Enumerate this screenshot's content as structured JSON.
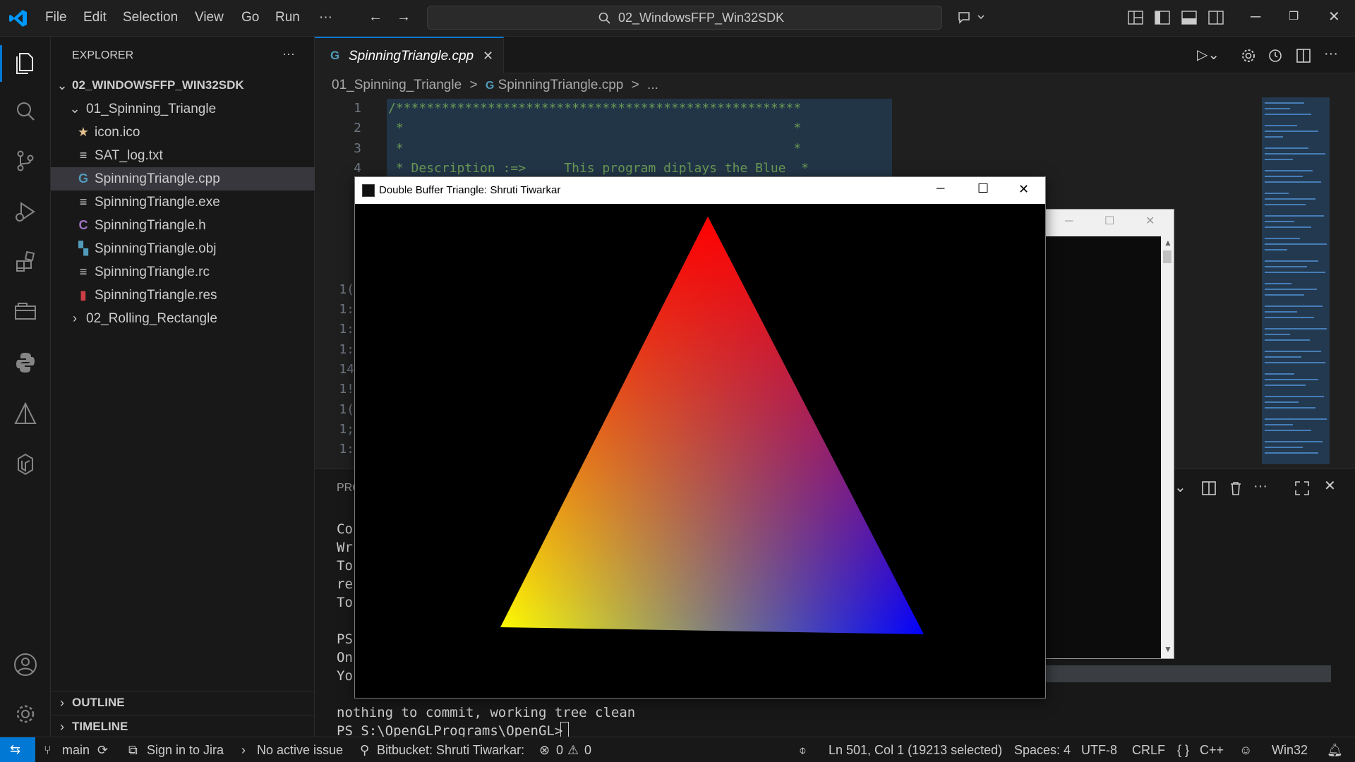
{
  "menu": [
    "File",
    "Edit",
    "Selection",
    "View",
    "Go",
    "Run",
    "···"
  ],
  "search": {
    "text": "02_WindowsFFP_Win32SDK"
  },
  "explorer": {
    "title": "EXPLORER",
    "more": "···",
    "root": "02_WINDOWSFFP_WIN32SDK",
    "folder1": "01_Spinning_Triangle",
    "files": [
      {
        "name": "icon.ico",
        "icon": "star-icon",
        "color": "#e2c08d",
        "glyph": "★"
      },
      {
        "name": "SAT_log.txt",
        "icon": "text-file-icon",
        "color": "#cccccc",
        "glyph": "≡"
      },
      {
        "name": "SpinningTriangle.cpp",
        "icon": "cpp-file-icon",
        "color": "#519aba",
        "glyph": "G"
      },
      {
        "name": "SpinningTriangle.exe",
        "icon": "text-file-icon",
        "color": "#cccccc",
        "glyph": "≡"
      },
      {
        "name": "SpinningTriangle.h",
        "icon": "c-header-icon",
        "color": "#a074c4",
        "glyph": "C"
      },
      {
        "name": "SpinningTriangle.obj",
        "icon": "binary-file-icon",
        "color": "#519aba",
        "glyph": "▚"
      },
      {
        "name": "SpinningTriangle.rc",
        "icon": "text-file-icon",
        "color": "#cccccc",
        "glyph": "≡"
      },
      {
        "name": "SpinningTriangle.res",
        "icon": "resource-file-icon",
        "color": "#cc3e44",
        "glyph": "▮"
      }
    ],
    "folder2": "02_Rolling_Rectangle",
    "outline": "OUTLINE",
    "timeline": "TIMELINE"
  },
  "tab": {
    "label": "SpinningTriangle.cpp",
    "close": "✕"
  },
  "breadcrumb": {
    "folder": "01_Spinning_Triangle",
    "sep": ">",
    "file": "SpinningTriangle.cpp",
    "more": "..."
  },
  "code": {
    "line_numbers": [
      "1",
      "2",
      "3",
      "4"
    ],
    "lines": [
      "/*****************************************************",
      " *                                                   *",
      " *                                                   *",
      " * Description :=>     This program diplays the Blue  *"
    ],
    "partial_numbers": [
      "1(",
      "1:",
      "1:",
      "1:",
      "14",
      "1!",
      "1(",
      "1;",
      "1:"
    ]
  },
  "panel": {
    "tab_label": "PRO",
    "terminal_partial": [
      "Co",
      "Wr",
      "To",
      "re",
      "To",
      "",
      "PS",
      "On",
      "Yo"
    ],
    "terminal_lines": [
      "nothing to commit, working tree clean",
      "PS S:\\OpenGLPrograms\\OpenGL> "
    ]
  },
  "gl_window": {
    "title": "Double Buffer Triangle: Shruti Tiwarkar",
    "min": "─",
    "max": "☐",
    "close": "✕",
    "colors": {
      "top": "#ff0000",
      "left": "#ffff00",
      "right": "#0000ff"
    }
  },
  "console_window": {
    "min": "─",
    "max": "☐",
    "close": "✕"
  },
  "statusbar": {
    "remote": "⇆",
    "branch": "main",
    "jira": "Sign in to Jira",
    "issue": "No active issue",
    "bitbucket": "Bitbucket: Shruti Tiwarkar:",
    "errors": "0",
    "warnings": "0",
    "position": "Ln 501, Col 1 (19213 selected)",
    "spaces": "Spaces: 4",
    "encoding": "UTF-8",
    "eol": "CRLF",
    "language": "C++",
    "platform": "Win32"
  },
  "colors": {
    "accent": "#0078d4",
    "remote_bg": "#0078d4"
  }
}
